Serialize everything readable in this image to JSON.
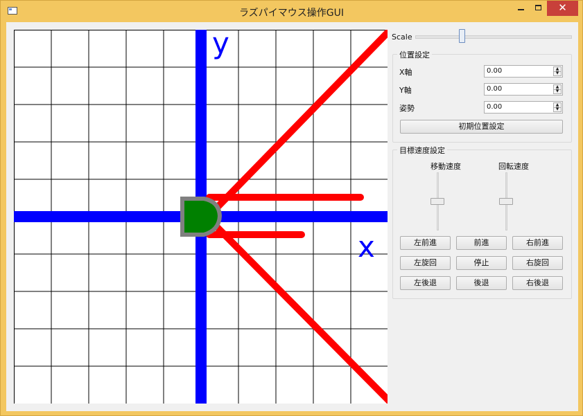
{
  "window": {
    "title": "ラズパイマウス操作GUI",
    "controls": {
      "minimize": "minimize",
      "maximize": "maximize",
      "close": "✕"
    }
  },
  "canvas": {
    "axis_x_label": "x",
    "axis_y_label": "y",
    "colors": {
      "grid": "#000000",
      "axis": "#0000ff",
      "sensor": "#ff0000",
      "robot_body": "#008000",
      "robot_border": "#808080"
    }
  },
  "panel": {
    "scale": {
      "label": "Scale",
      "value_fraction": 0.3
    },
    "position_group": {
      "title": "位置設定",
      "rows": [
        {
          "label": "X軸",
          "value": "0.00"
        },
        {
          "label": "Y軸",
          "value": "0.00"
        },
        {
          "label": "姿勢",
          "value": "0.00"
        }
      ],
      "reset_button": "初期位置設定"
    },
    "speed_group": {
      "title": "目標速度設定",
      "linear_label": "移動速度",
      "angular_label": "回転速度",
      "linear_value_fraction": 0.5,
      "angular_value_fraction": 0.5,
      "buttons": [
        [
          "左前進",
          "前進",
          "右前進"
        ],
        [
          "左旋回",
          "停止",
          "右旋回"
        ],
        [
          "左後退",
          "後退",
          "右後退"
        ]
      ]
    }
  }
}
